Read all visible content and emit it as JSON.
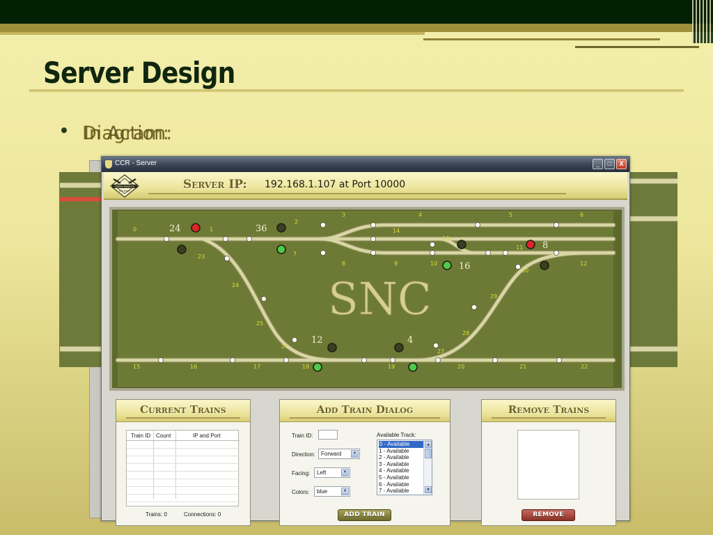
{
  "slide": {
    "title": "Server Design",
    "bullet_text": "Diagram:",
    "bullet_overlap_text": "In Action:"
  },
  "window": {
    "title": "CCR - Server",
    "minimize_glyph": "_",
    "maximize_glyph": "□",
    "close_glyph": "X"
  },
  "header": {
    "logo_text": "GREEN KNIGHTS RAILROAD",
    "server_ip_label": "Server IP:",
    "server_ip_value": "192.168.1.107 at Port 10000"
  },
  "track": {
    "center_label": "SNC",
    "segments": [
      "0",
      "1",
      "2",
      "3",
      "4",
      "5",
      "6",
      "7",
      "8",
      "9",
      "10",
      "11",
      "12",
      "13",
      "14",
      "15",
      "16",
      "17",
      "18",
      "19",
      "20",
      "21",
      "22",
      "23",
      "24",
      "25",
      "26",
      "27",
      "28",
      "29",
      "30"
    ],
    "signals": [
      {
        "id": "24",
        "state": "red"
      },
      {
        "id": "36",
        "state": "off"
      },
      {
        "id": "7",
        "state": "green"
      },
      {
        "id": "23",
        "state": "off"
      },
      {
        "id": "16",
        "state": "green"
      },
      {
        "id": "13",
        "state": "off"
      },
      {
        "id": "8",
        "state": "red"
      },
      {
        "id": "30",
        "state": "off"
      },
      {
        "id": "12",
        "state": "off"
      },
      {
        "id": "4",
        "state": "off"
      },
      {
        "id": "18",
        "state": "green"
      },
      {
        "id": "19",
        "state": "green"
      }
    ],
    "colors": {
      "background": "#6d7a36",
      "rail": "#d9d6a6",
      "red": "#e2222a",
      "green": "#4fc94a",
      "off": "#3a3f22"
    }
  },
  "current_trains": {
    "title": "Current Trains",
    "columns": [
      "Train ID",
      "Count",
      "IP and Port"
    ],
    "rows": [],
    "trains_status": "Trains: 0",
    "connections_status": "Connections: 0"
  },
  "add_train": {
    "title": "Add Train Dialog",
    "train_id_label": "Train ID:",
    "train_id_value": "",
    "direction_label": "Direction:",
    "direction_value": "Forward",
    "facing_label": "Facing:",
    "facing_value": "Left",
    "colors_label": "Colors:",
    "colors_value": "blue",
    "available_track_label": "Available Track:",
    "available_tracks": [
      "0 - Available",
      "1 - Available",
      "2 - Available",
      "3 - Available",
      "4 - Available",
      "5 - Available",
      "6 - Available",
      "7 - Available"
    ],
    "selected_track": "0 - Available",
    "add_button": "ADD TRAIN"
  },
  "remove_trains": {
    "title": "Remove Trains",
    "items": [],
    "remove_button": "REMOVE"
  }
}
